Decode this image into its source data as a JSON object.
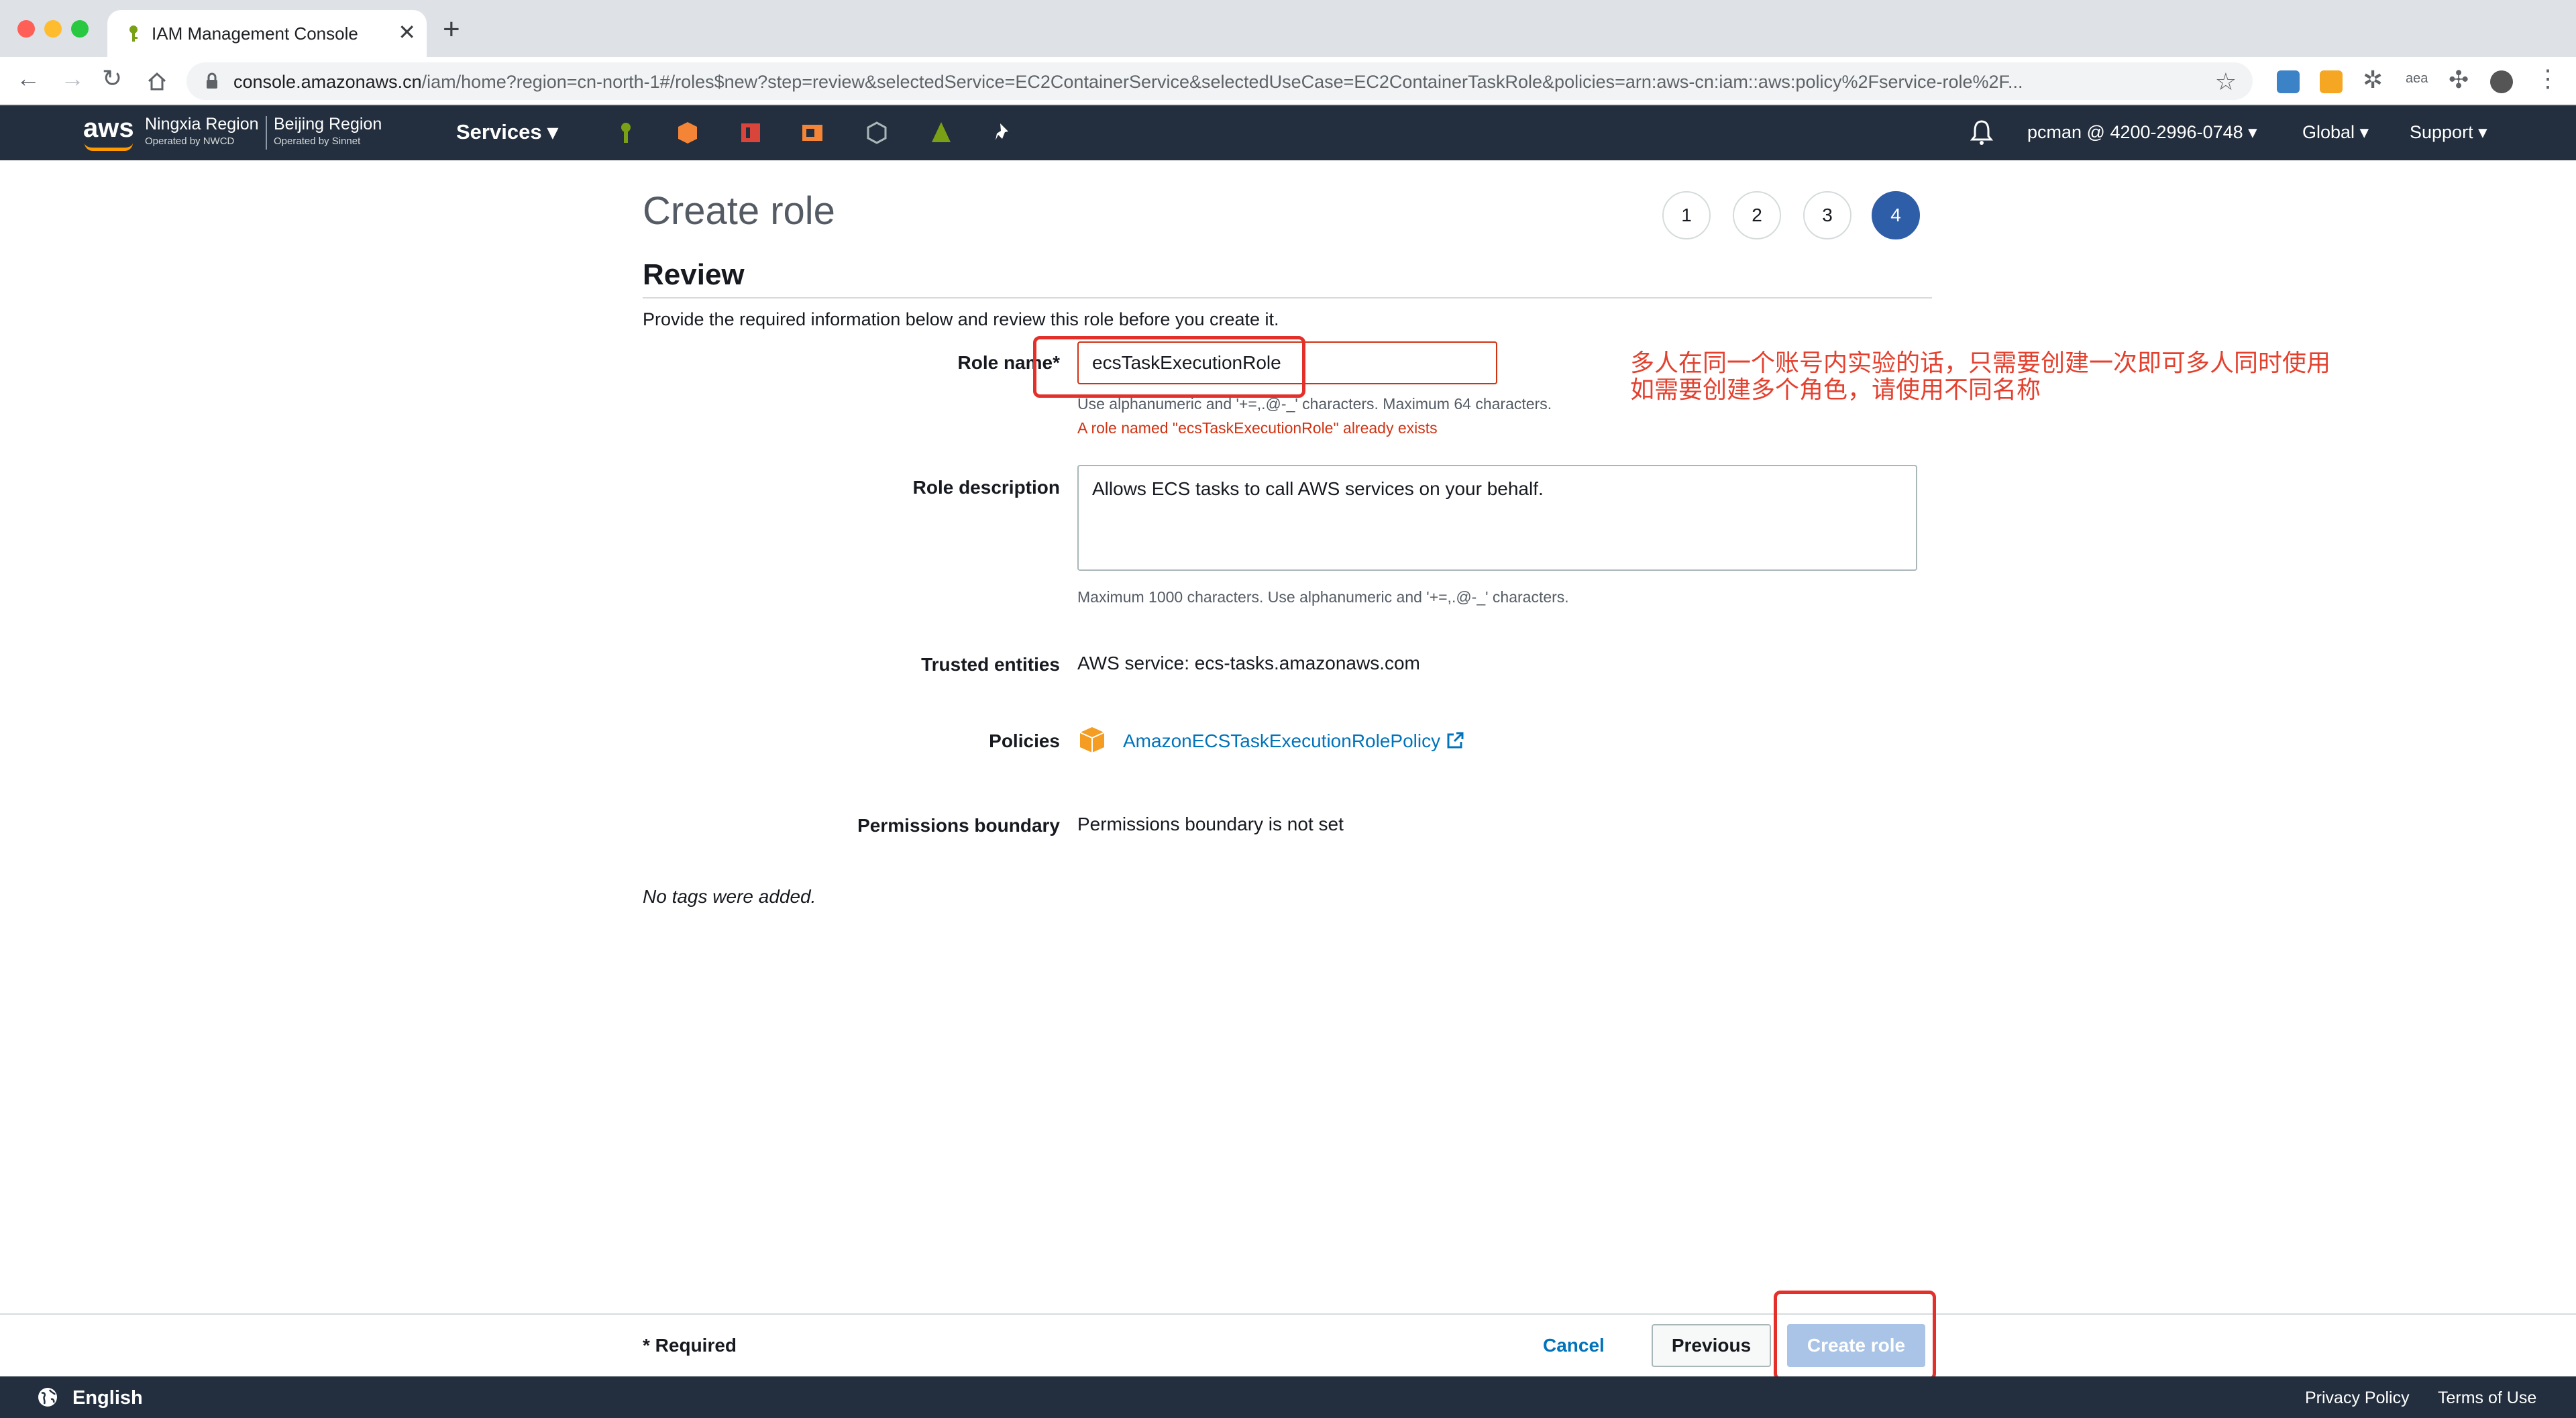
{
  "browser": {
    "tab_title": "IAM Management Console",
    "tab_close": "✕",
    "new_tab": "+",
    "url_host": "console.amazonaws.cn",
    "url_rest": "/iam/home?region=cn-north-1#/roles$new?step=review&selectedService=EC2ContainerService&selectedUseCase=EC2ContainerTaskRole&policies=arn:aws-cn:iam::aws:policy%2Fservice-role%2F..."
  },
  "awsnav": {
    "logo": "aws",
    "region1_name": "Ningxia Region",
    "region1_sub": "Operated by NWCD",
    "region2_name": "Beijing Region",
    "region2_sub": "Operated by Sinnet",
    "services": "Services ▾",
    "account": "pcman @ 4200-2996-0748 ▾",
    "global": "Global ▾",
    "support": "Support ▾"
  },
  "page": {
    "title": "Create role",
    "steps": [
      "1",
      "2",
      "3",
      "4"
    ],
    "active_step": "4",
    "section_title": "Review",
    "intro": "Provide the required information below and review this role before you create it."
  },
  "form": {
    "role_name_label": "Role name*",
    "role_name_value": "ecsTaskExecutionRole",
    "role_name_hint": "Use alphanumeric and '+=,.@-_' characters. Maximum 64 characters.",
    "role_name_error": "A role named \"ecsTaskExecutionRole\" already exists",
    "role_desc_label": "Role description",
    "role_desc_value": "Allows ECS tasks to call AWS services on your behalf.",
    "role_desc_hint": "Maximum 1000 characters. Use alphanumeric and '+=,.@-_' characters.",
    "trusted_label": "Trusted entities",
    "trusted_value": "AWS service: ecs-tasks.amazonaws.com",
    "policies_label": "Policies",
    "policy_name": "AmazonECSTaskExecutionRolePolicy",
    "boundary_label": "Permissions boundary",
    "boundary_value": "Permissions boundary is not set",
    "no_tags": "No tags were added."
  },
  "annotation": {
    "line1": "多人在同一个账号内实验的话，只需要创建一次即可多人同时使用",
    "line2": "如需要创建多个角色，请使用不同名称",
    "color": "#e4402e"
  },
  "footer": {
    "required": "* Required",
    "cancel": "Cancel",
    "previous": "Previous",
    "create": "Create role"
  },
  "bottombar": {
    "language": "English",
    "privacy": "Privacy Policy",
    "terms": "Terms of Use"
  },
  "colors": {
    "aws_nav": "#232f3e",
    "active_step": "#2e5ea8",
    "link": "#0073bb",
    "error": "#d13212",
    "create_disabled": "#a9c4e6"
  }
}
